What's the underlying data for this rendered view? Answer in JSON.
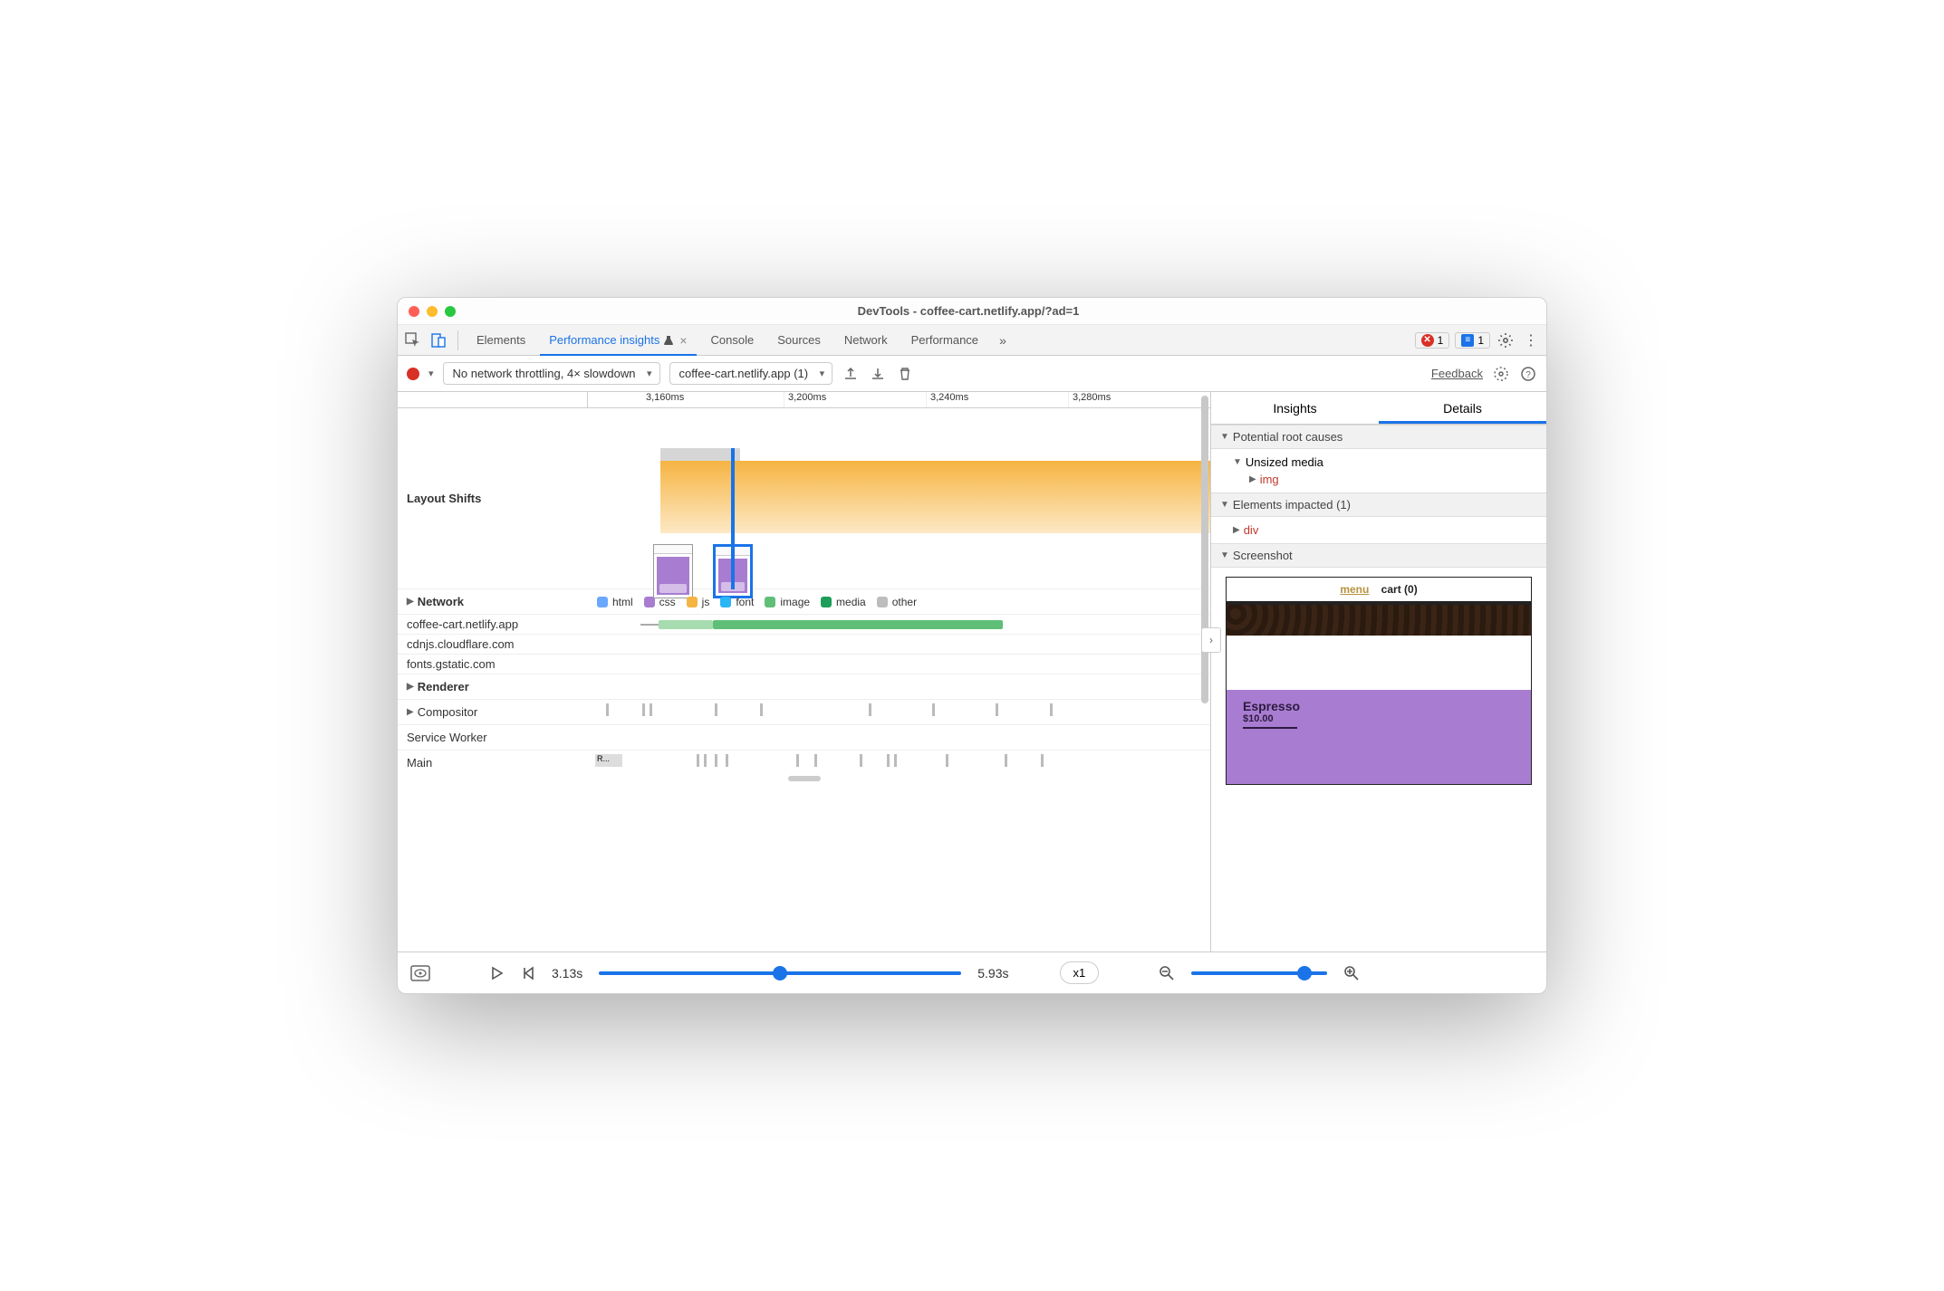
{
  "window": {
    "title": "DevTools - coffee-cart.netlify.app/?ad=1"
  },
  "tabs": {
    "items": [
      "Elements",
      "Performance insights",
      "Console",
      "Sources",
      "Network",
      "Performance"
    ],
    "active": "Performance insights",
    "errors_count": "1",
    "messages_count": "1"
  },
  "toolbar": {
    "throttle": "No network throttling, 4× slowdown",
    "target": "coffee-cart.netlify.app (1)",
    "feedback": "Feedback"
  },
  "ruler": {
    "ticks": [
      "3,160ms",
      "3,200ms",
      "3,240ms",
      "3,280ms"
    ]
  },
  "timeline": {
    "layout_shifts_label": "Layout Shifts",
    "network_label": "Network",
    "network_hosts": [
      "coffee-cart.netlify.app",
      "cdnjs.cloudflare.com",
      "fonts.gstatic.com"
    ],
    "legend": [
      {
        "label": "html",
        "color": "#6aa7ff"
      },
      {
        "label": "css",
        "color": "#a87dd1"
      },
      {
        "label": "js",
        "color": "#f6b442"
      },
      {
        "label": "font",
        "color": "#29b6f6"
      },
      {
        "label": "image",
        "color": "#5fbf77"
      },
      {
        "label": "media",
        "color": "#1e9e58"
      },
      {
        "label": "other",
        "color": "#bdbdbd"
      }
    ],
    "renderer_label": "Renderer",
    "renderer_rows": [
      "Compositor",
      "Service Worker",
      "Main"
    ],
    "main_block": "R..."
  },
  "details": {
    "tab_insights": "Insights",
    "tab_details": "Details",
    "root_causes_hdr": "Potential root causes",
    "unsized_media": "Unsized media",
    "img_tag": "img",
    "impacted_hdr": "Elements impacted (1)",
    "div_tag": "div",
    "screenshot_hdr": "Screenshot",
    "preview": {
      "menu": "menu",
      "cart": "cart (0)",
      "product": "Espresso",
      "price": "$10.00"
    }
  },
  "status": {
    "time_start": "3.13s",
    "time_end": "5.93s",
    "zoom_level": "x1"
  }
}
